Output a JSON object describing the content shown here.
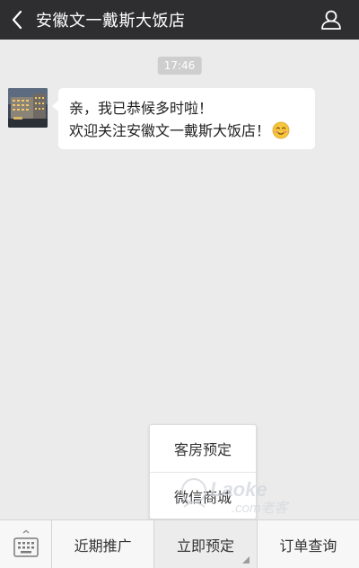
{
  "header": {
    "title": "安徽文一戴斯大饭店",
    "back_icon": "chevron-left-icon",
    "profile_icon": "person-icon",
    "background": "#2e2e30"
  },
  "chat": {
    "timestamp": "17:46",
    "message": {
      "line1": "亲，我已恭候多时啦！",
      "line2": "欢迎关注安徽文一戴斯大饭店！",
      "emoji": "smiling-face-emoji"
    }
  },
  "popup_menu": {
    "items": [
      "客房预定",
      "微信商城"
    ]
  },
  "watermark": {
    "brand": "Laoke",
    "domain": ".com老客"
  },
  "bottom_bar": {
    "keyboard_icon": "keyboard-icon",
    "menus": [
      "近期推广",
      "立即预定",
      "订单查询"
    ]
  }
}
